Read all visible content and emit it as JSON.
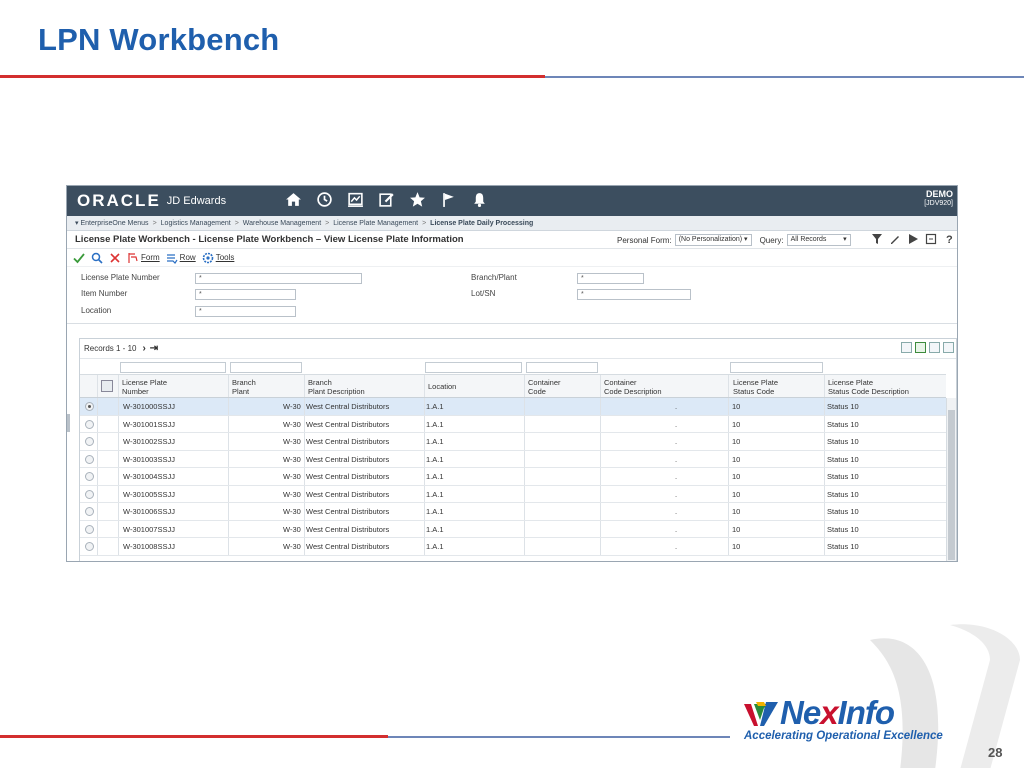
{
  "slide": {
    "title": "LPN Workbench",
    "page_number": "28",
    "logo": {
      "name_prefix": "Ne",
      "name_x": "x",
      "name_suffix": "Info",
      "tagline": "Accelerating Operational Excellence"
    }
  },
  "app": {
    "brand": "ORACLE",
    "product": "JD Edwards",
    "environment": "DEMO",
    "environment_sub": "[JDV920]",
    "nav_icons": [
      "home-icon",
      "recent-icon",
      "dashboard-icon",
      "edit-icon",
      "favorites-star-icon",
      "flag-icon",
      "bell-icon"
    ],
    "breadcrumb": [
      "EnterpriseOne Menus",
      "Logistics Management",
      "Warehouse Management",
      "License Plate Management",
      "License Plate Daily Processing"
    ],
    "form_title": "License Plate Workbench - License Plate Workbench – View License Plate Information",
    "personal_form_label": "Personal Form:",
    "personal_form_value": "(No Personalization)",
    "query_label": "Query:",
    "query_value": "All Records",
    "toolbar": {
      "form": "Form",
      "row": "Row",
      "tools": "Tools"
    },
    "filters": {
      "license_plate_number": {
        "label": "License Plate Number",
        "value": "*"
      },
      "item_number": {
        "label": "Item Number",
        "value": "*"
      },
      "location": {
        "label": "Location",
        "value": "*"
      },
      "branch_plant": {
        "label": "Branch/Plant",
        "value": "*"
      },
      "lot_sn": {
        "label": "Lot/SN",
        "value": "*"
      }
    },
    "records_label": "Records 1 - 10",
    "columns": [
      {
        "l1": "License Plate",
        "l2": "Number"
      },
      {
        "l1": "Branch",
        "l2": "Plant"
      },
      {
        "l1": "Branch",
        "l2": "Plant Description"
      },
      {
        "l1": "Location",
        "l2": ""
      },
      {
        "l1": "Container",
        "l2": "Code"
      },
      {
        "l1": "Container",
        "l2": "Code Description"
      },
      {
        "l1": "License Plate",
        "l2": "Status Code"
      },
      {
        "l1": "License Plate",
        "l2": "Status Code Description"
      }
    ],
    "rows": [
      {
        "lpn": "W-301000SSJJ",
        "branch": "W-30",
        "desc": "West Central Distributors",
        "loc": "1.A.1",
        "cdesc": ".",
        "code": "10",
        "status": "Status 10"
      },
      {
        "lpn": "W-301001SSJJ",
        "branch": "W-30",
        "desc": "West Central Distributors",
        "loc": "1.A.1",
        "cdesc": ".",
        "code": "10",
        "status": "Status 10"
      },
      {
        "lpn": "W-301002SSJJ",
        "branch": "W-30",
        "desc": "West Central Distributors",
        "loc": "1.A.1",
        "cdesc": ".",
        "code": "10",
        "status": "Status 10"
      },
      {
        "lpn": "W-301003SSJJ",
        "branch": "W-30",
        "desc": "West Central Distributors",
        "loc": "1.A.1",
        "cdesc": ".",
        "code": "10",
        "status": "Status 10"
      },
      {
        "lpn": "W-301004SSJJ",
        "branch": "W-30",
        "desc": "West Central Distributors",
        "loc": "1.A.1",
        "cdesc": ".",
        "code": "10",
        "status": "Status 10"
      },
      {
        "lpn": "W-301005SSJJ",
        "branch": "W-30",
        "desc": "West Central Distributors",
        "loc": "1.A.1",
        "cdesc": ".",
        "code": "10",
        "status": "Status 10"
      },
      {
        "lpn": "W-301006SSJJ",
        "branch": "W-30",
        "desc": "West Central Distributors",
        "loc": "1.A.1",
        "cdesc": ".",
        "code": "10",
        "status": "Status 10"
      },
      {
        "lpn": "W-301007SSJJ",
        "branch": "W-30",
        "desc": "West Central Distributors",
        "loc": "1.A.1",
        "cdesc": ".",
        "code": "10",
        "status": "Status 10"
      },
      {
        "lpn": "W-301008SSJJ",
        "branch": "W-30",
        "desc": "West Central Distributors",
        "loc": "1.A.1",
        "cdesc": ".",
        "code": "10",
        "status": "Status 10"
      }
    ]
  }
}
